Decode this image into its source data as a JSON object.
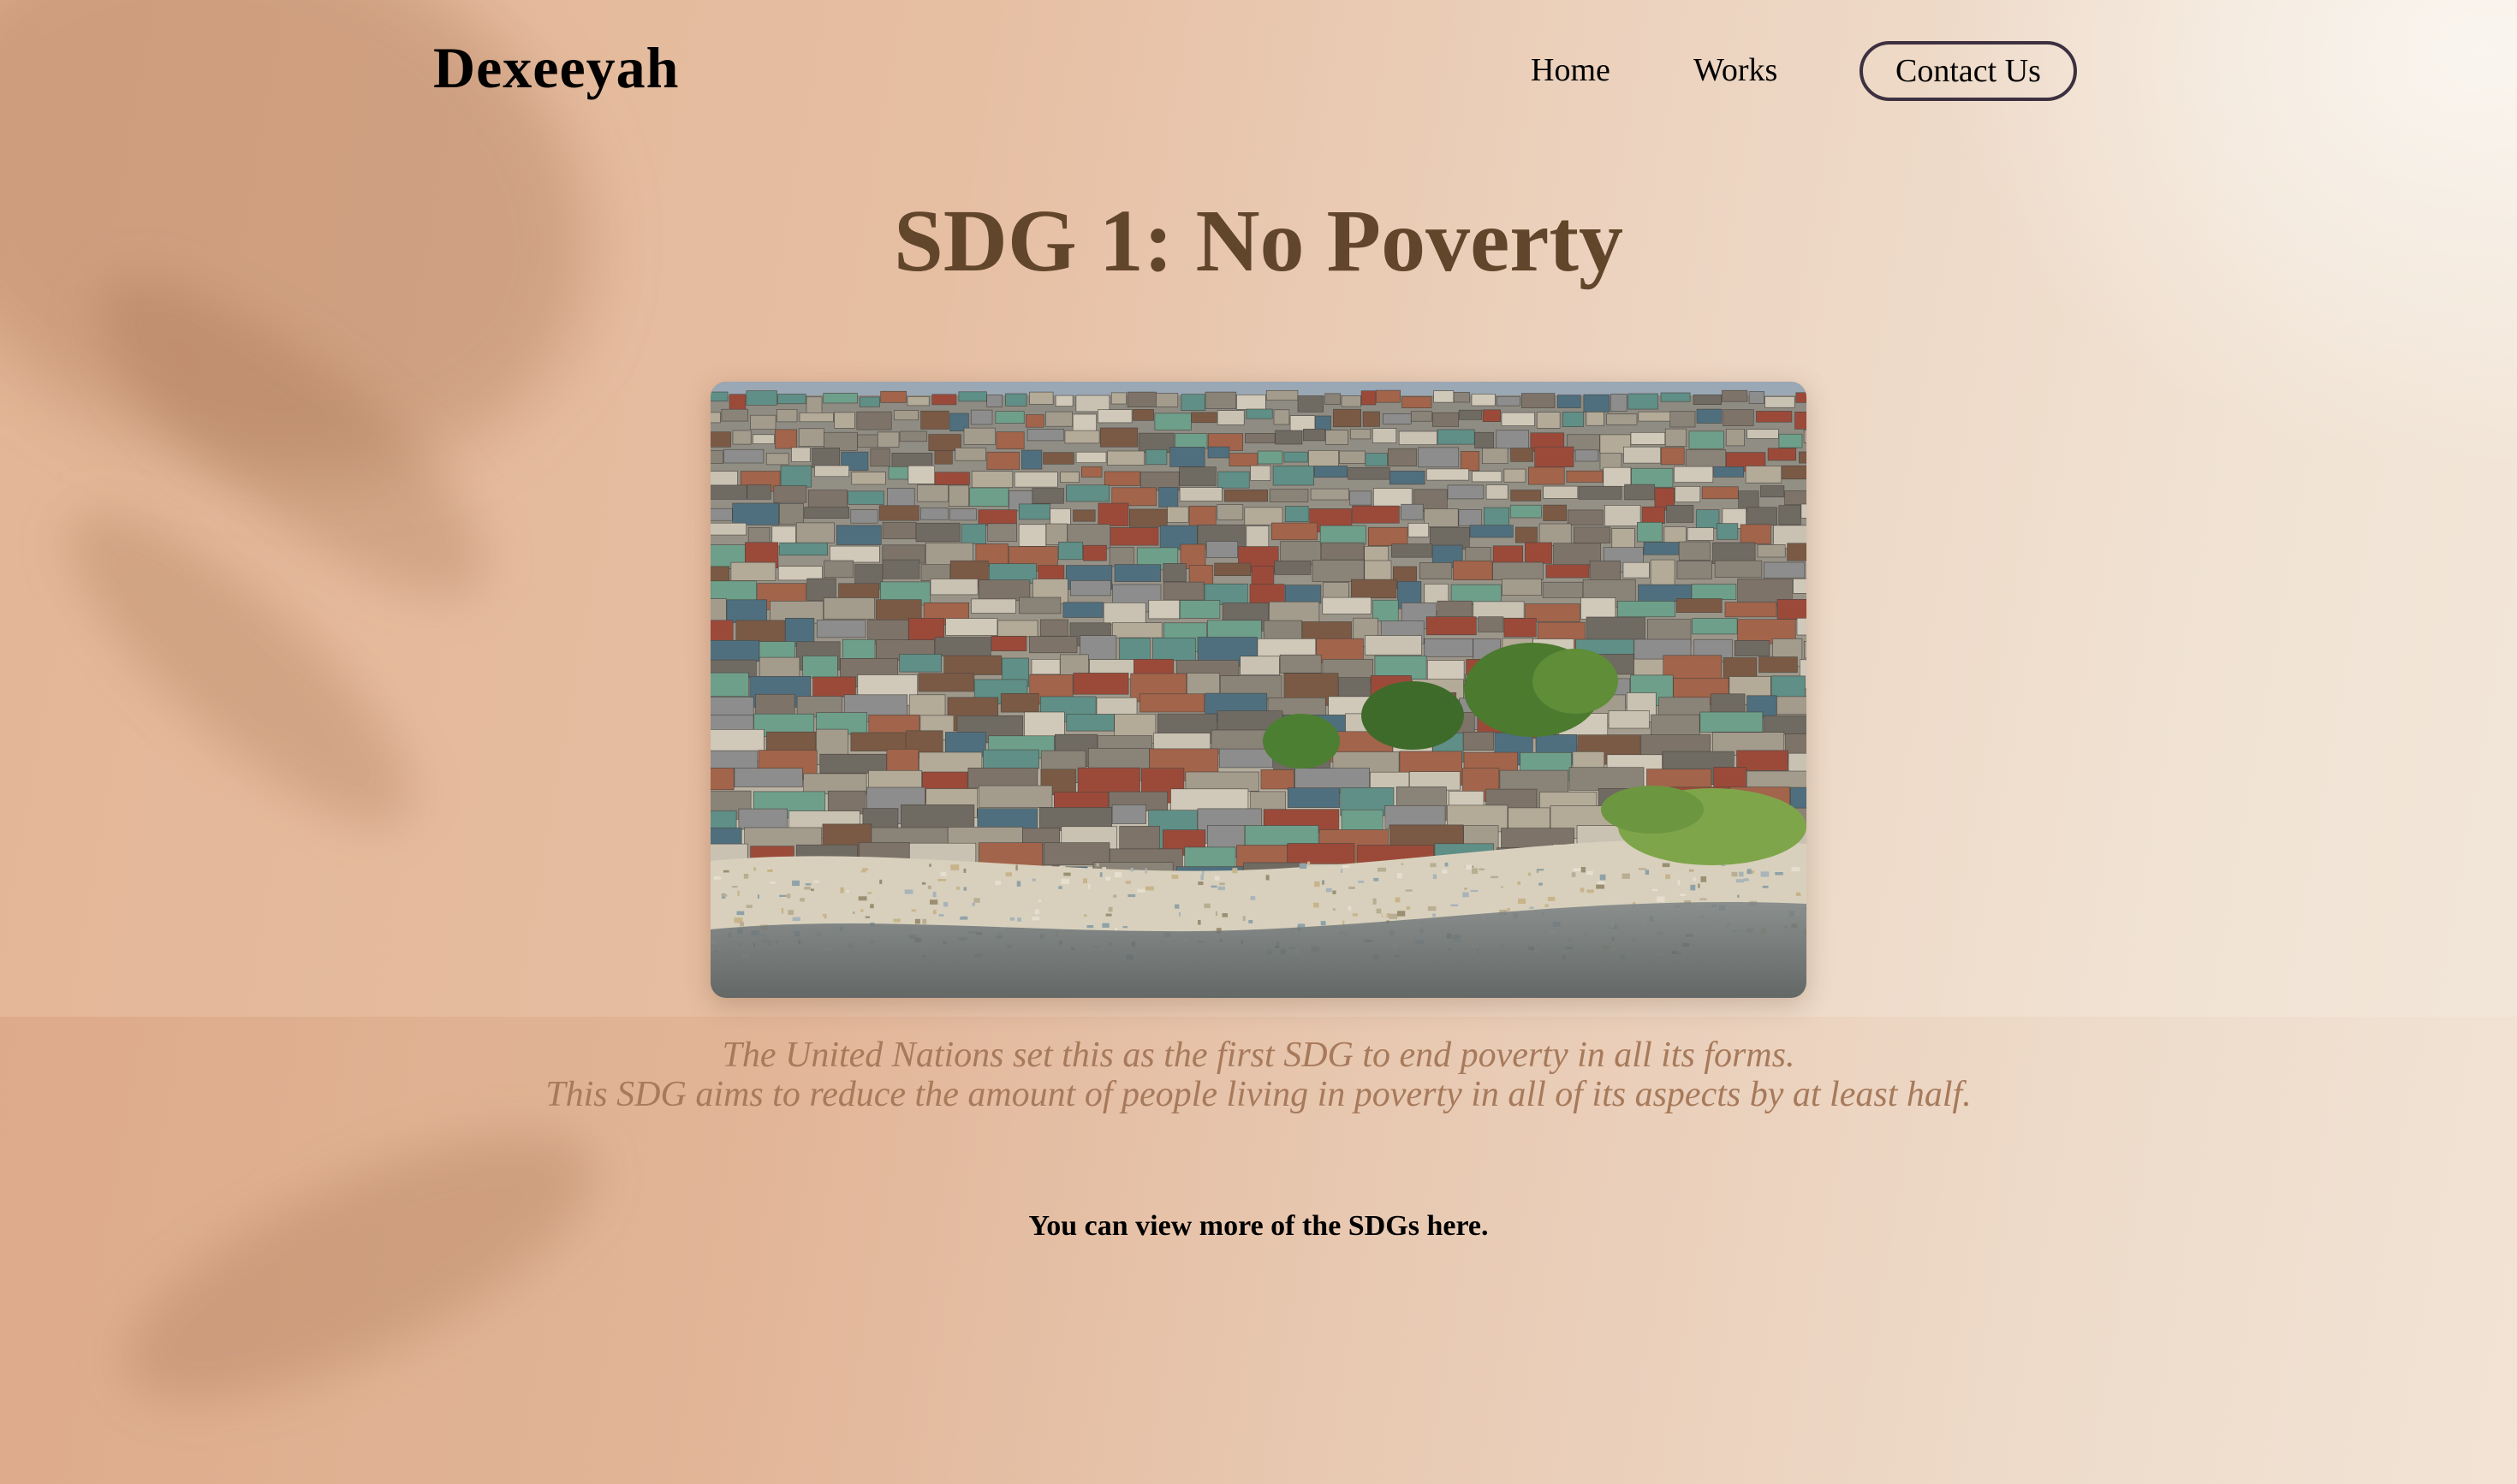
{
  "header": {
    "logo": "Dexeeyah",
    "nav": {
      "home_label": "Home",
      "works_label": "Works",
      "contact_label": "Contact Us"
    }
  },
  "main": {
    "title": "SDG 1: No Poverty",
    "description": {
      "line1": "The United Nations set this as the first SDG to end poverty in all its forms.",
      "line2": "This SDG aims to reduce the amount of people living in poverty in all of its aspects by at least half."
    },
    "more_link": "You can view more of the SDGs here."
  },
  "colors": {
    "title": "#62462c",
    "description": "#a77a5b",
    "button_border": "#3d3040",
    "background_warm": "#e3b596",
    "background_light": "#f3e7da"
  }
}
